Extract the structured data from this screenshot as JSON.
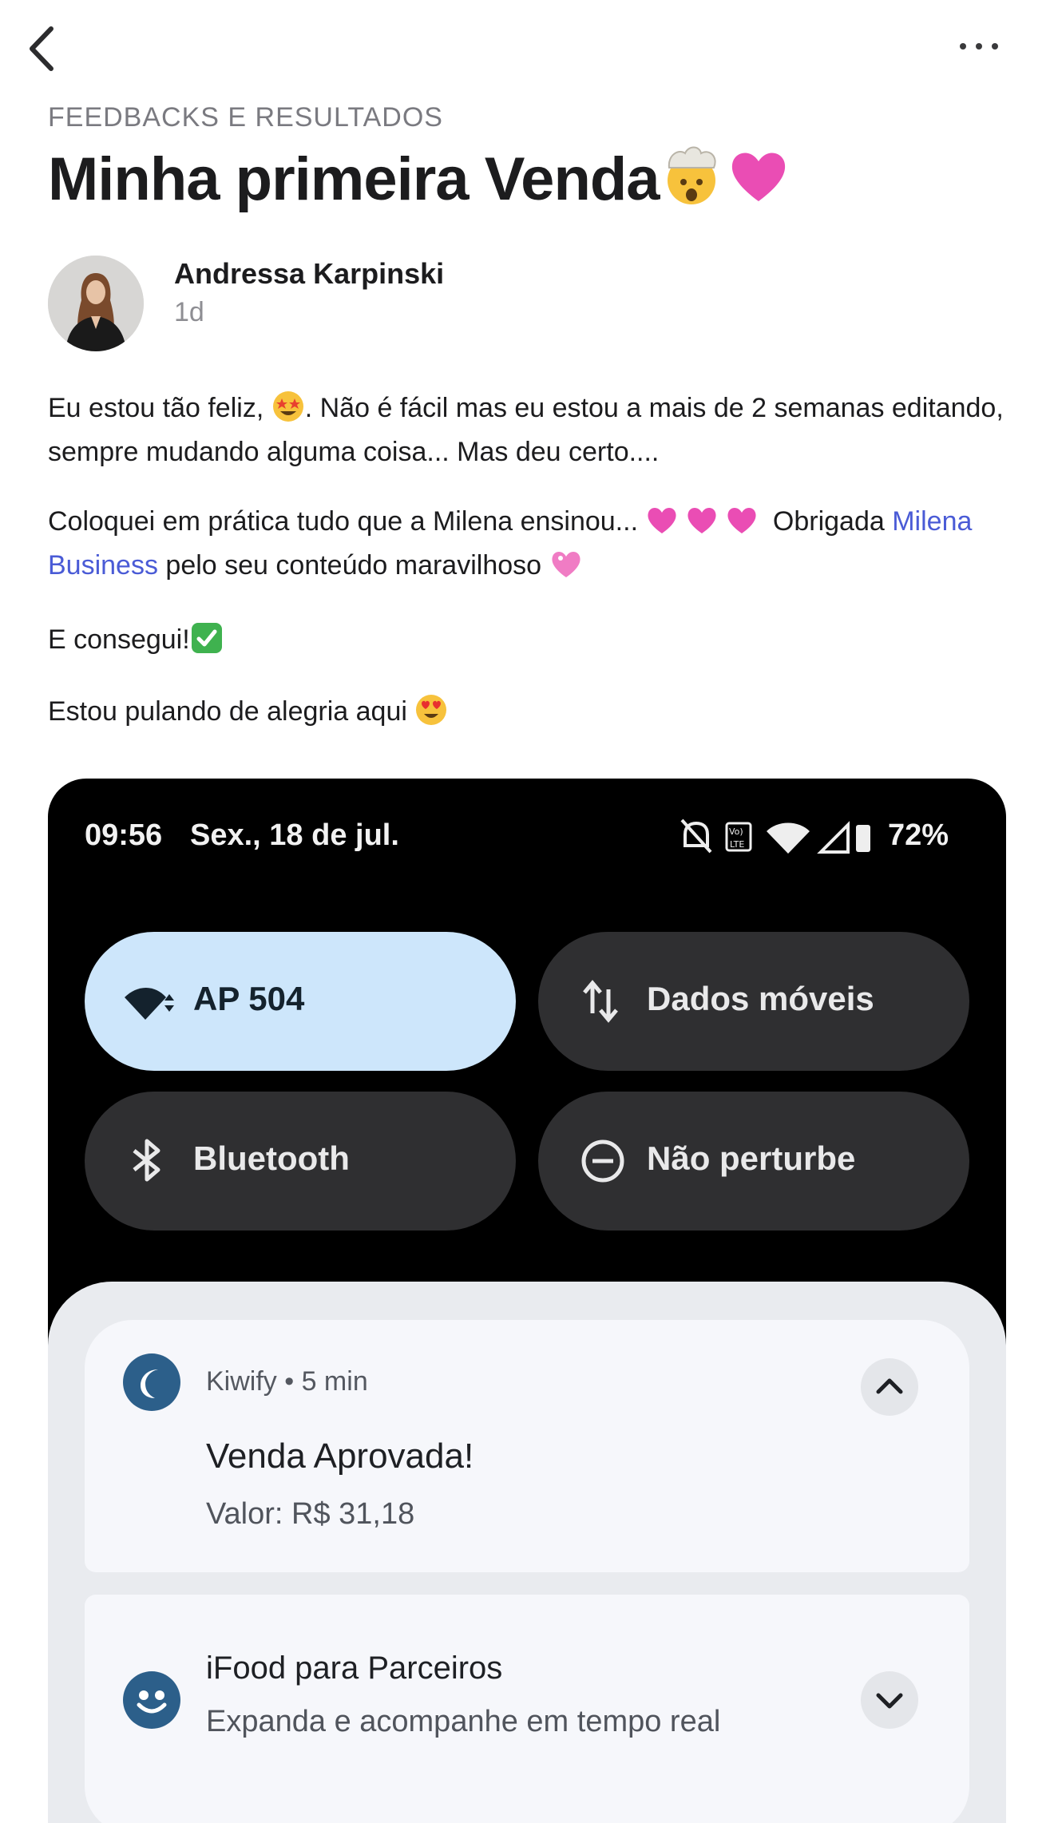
{
  "header": {
    "back_icon": "chevron-left-icon",
    "more_icon": "more-horizontal-icon"
  },
  "post": {
    "category": "FEEDBACKS E RESULTADOS",
    "title": "Minha primeira Venda",
    "title_emojis": [
      "exploding-head-emoji",
      "pink-heart-emoji"
    ],
    "author": {
      "name": "Andressa Karpinski",
      "time": "1d"
    },
    "paragraphs": {
      "p1_a": "Eu estou tão feliz, ",
      "p1_b": ". Não é fácil mas eu estou a mais de 2 semanas editando, sempre mudando alguma coisa... Mas deu certo....",
      "p2_a": "Coloquei em prática tudo que a Milena ensinou... ",
      "p2_b": " Obrigada ",
      "p2_link": "Milena Business",
      "p2_c": " pelo seu conteúdo maravilhoso ",
      "p3": "E consegui!",
      "p4": "Estou pulando de alegria aqui "
    }
  },
  "screenshot": {
    "status_bar": {
      "time": "09:56",
      "date": "Sex., 18 de jul.",
      "battery": "72%"
    },
    "tiles": [
      {
        "label": "AP 504",
        "icon": "wifi-icon",
        "active": true
      },
      {
        "label": "Dados móveis",
        "icon": "mobile-data-icon",
        "active": false
      },
      {
        "label": "Bluetooth",
        "icon": "bluetooth-icon",
        "active": false
      },
      {
        "label": "Não perturbe",
        "icon": "do-not-disturb-icon",
        "active": false
      }
    ],
    "notifications": [
      {
        "app": "Kiwify • 5 min",
        "title": "Venda Aprovada!",
        "body": "Valor: R$ 31,18",
        "chevron": "chevron-up-icon"
      },
      {
        "title": "iFood para Parceiros",
        "body": "Expanda e acompanhe em tempo real",
        "chevron": "chevron-down-icon"
      }
    ]
  },
  "colors": {
    "link": "#4a5bd6",
    "accent_tile": "#cde6fb",
    "notif_icon": "#2c5f8a"
  }
}
